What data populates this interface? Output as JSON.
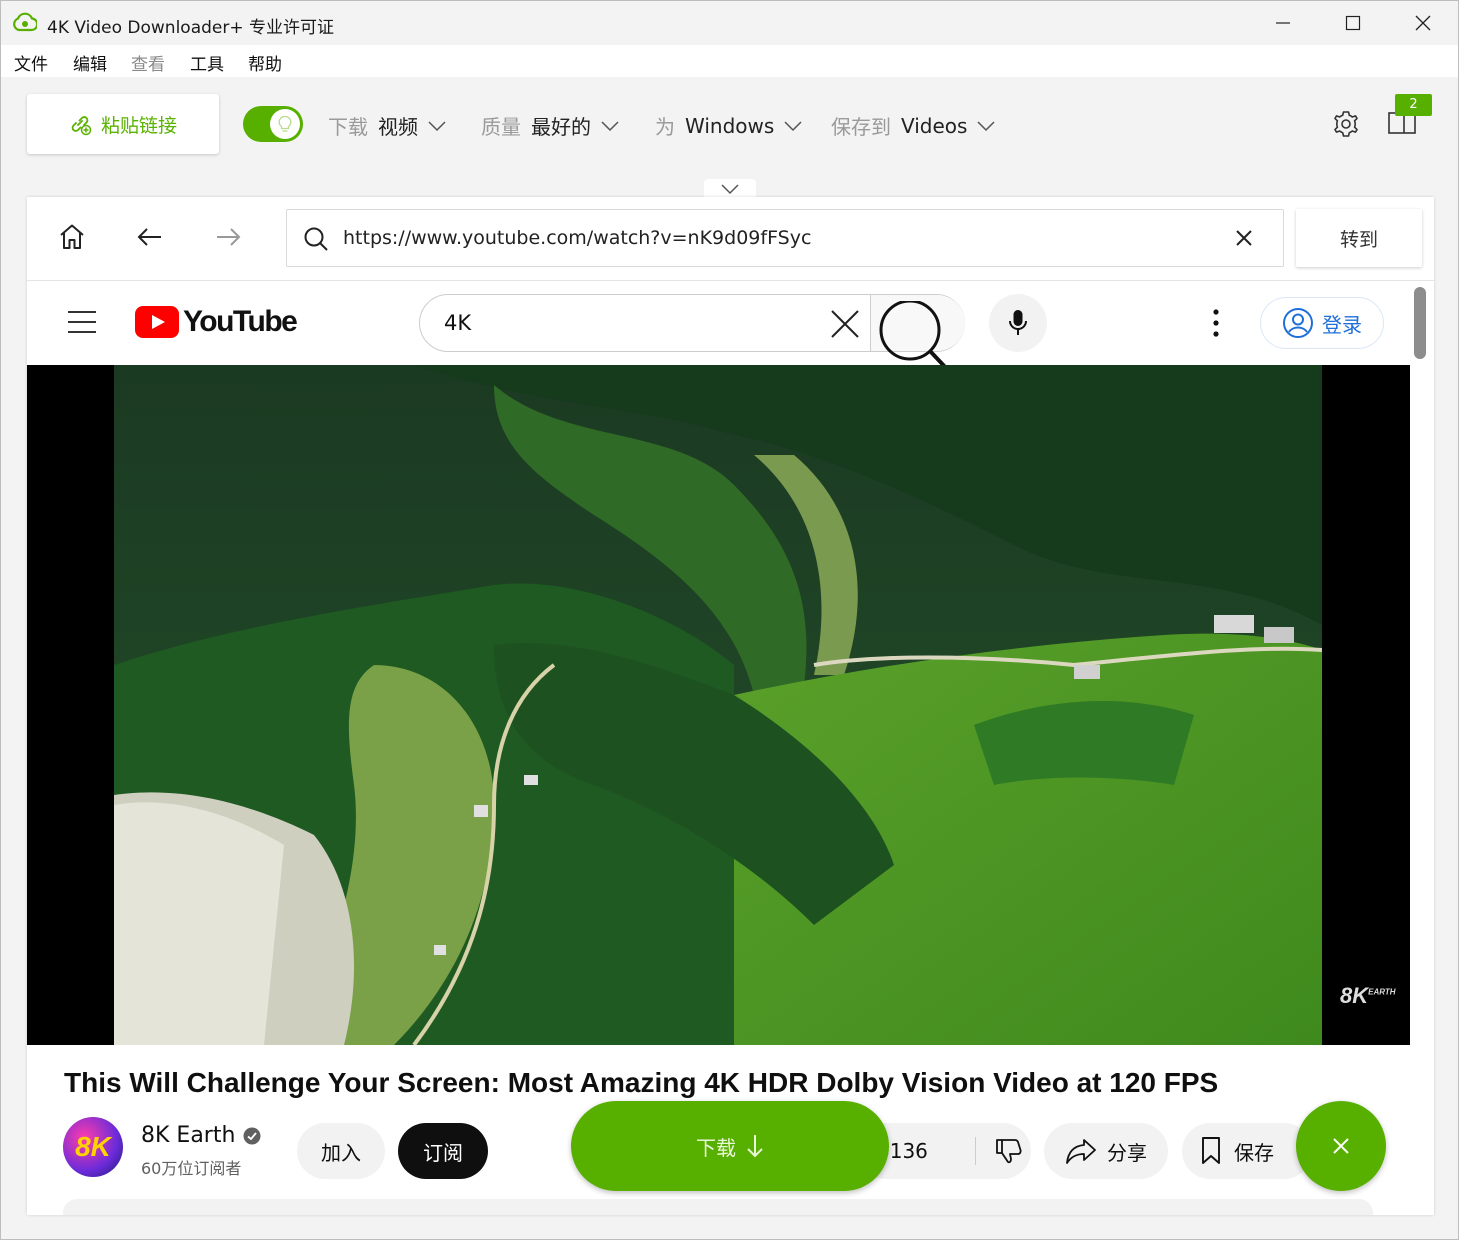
{
  "window": {
    "title": "4K Video Downloader+ 专业许可证"
  },
  "menu": [
    "文件",
    "编辑",
    "查看",
    "工具",
    "帮助"
  ],
  "toolbar": {
    "paste_label": "粘贴链接",
    "download_label": "下载",
    "download_value": "视频",
    "quality_label": "质量",
    "quality_value": "最好的",
    "for_label": "为",
    "for_value": "Windows",
    "save_label": "保存到",
    "save_value": "Videos",
    "badge_count": "2"
  },
  "browser": {
    "url": "https://www.youtube.com/watch?v=nK9d09fFSyc",
    "go_label": "转到"
  },
  "youtube": {
    "logo_text": "YouTube",
    "search_value": "4K",
    "signin_label": "登录",
    "video_title": "This Will Challenge Your Screen: Most Amazing 4K HDR Dolby Vision Video at 120 FPS",
    "watermark": "8K",
    "watermark_small": "EARTH",
    "channel_avatar_text": "8K",
    "channel_name": "8K Earth",
    "subscribers": "60万位订阅者",
    "join_label": "加入",
    "subscribe_label": "订阅",
    "like_count": "3136",
    "share_label": "分享",
    "save_label": "保存"
  },
  "floating": {
    "download_label": "下载"
  },
  "colors": {
    "accent_green": "#57b000",
    "youtube_red": "#ff0000",
    "link_blue": "#1e6fd9"
  }
}
